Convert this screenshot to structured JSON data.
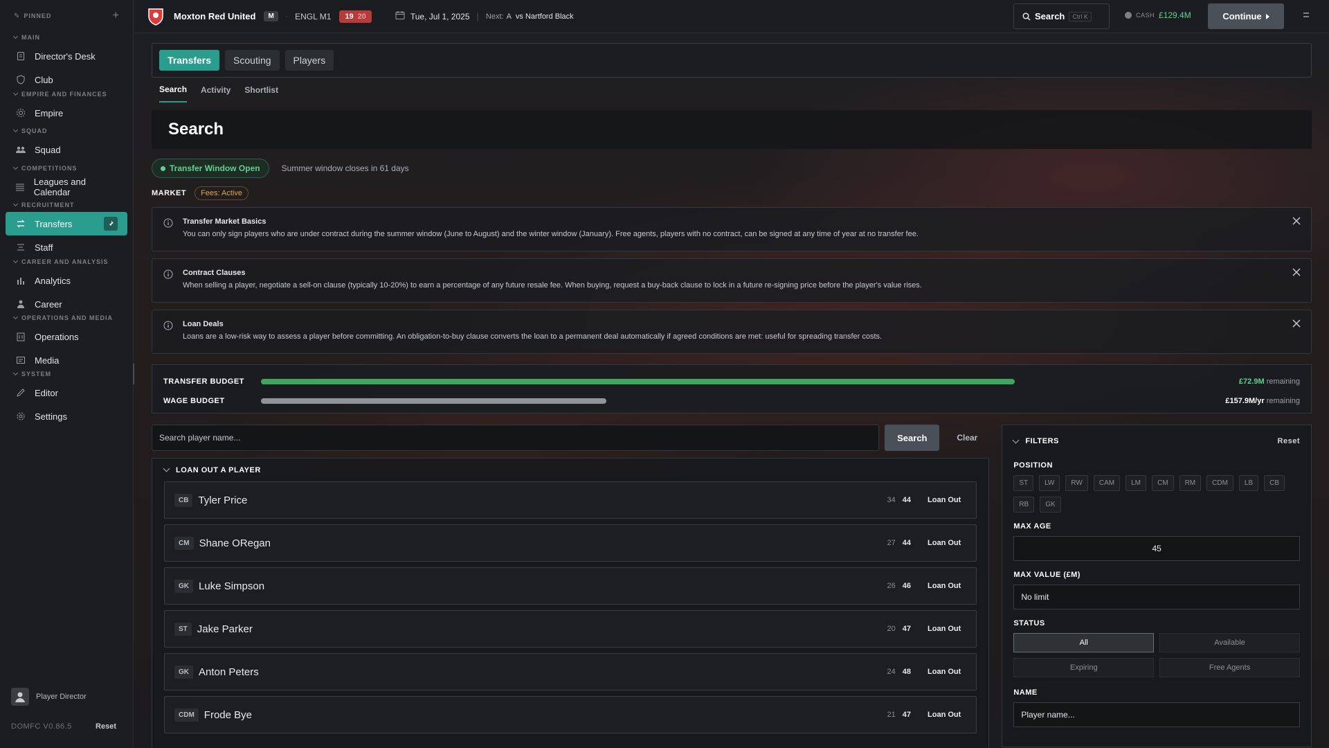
{
  "sidebar": {
    "pinned_label": "PINNED",
    "sections": [
      {
        "label": "MAIN",
        "items": [
          {
            "label": "Director's Desk",
            "icon": "document-icon"
          },
          {
            "label": "Club",
            "icon": "shield-icon"
          }
        ]
      },
      {
        "label": "EMPIRE AND FINANCES",
        "items": [
          {
            "label": "Empire",
            "icon": "gear-icon"
          }
        ]
      },
      {
        "label": "SQUAD",
        "items": [
          {
            "label": "Squad",
            "icon": "people-icon"
          }
        ]
      },
      {
        "label": "COMPETITIONS",
        "items": [
          {
            "label": "Leagues and Calendar",
            "icon": "list-icon"
          }
        ]
      },
      {
        "label": "RECRUITMENT",
        "items": [
          {
            "label": "Transfers",
            "icon": "swap-icon"
          },
          {
            "label": "Staff",
            "icon": "staff-icon"
          }
        ]
      },
      {
        "label": "CAREER AND ANALYSIS",
        "items": [
          {
            "label": "Analytics",
            "icon": "bar-chart-icon"
          },
          {
            "label": "Career",
            "icon": "person-icon"
          }
        ]
      },
      {
        "label": "OPERATIONS AND MEDIA",
        "items": [
          {
            "label": "Operations",
            "icon": "building-icon"
          },
          {
            "label": "Media",
            "icon": "media-icon"
          }
        ]
      },
      {
        "label": "SYSTEM",
        "items": [
          {
            "label": "Editor",
            "icon": "pencil-icon"
          },
          {
            "label": "Settings",
            "icon": "settings-icon"
          }
        ]
      }
    ],
    "user_label": "Player Director",
    "version": "DOMFC V0.86.5",
    "reset_label": "Reset"
  },
  "topbar": {
    "club_name": "Moxton Red United",
    "mode_badge": "M",
    "league": "ENGL M1",
    "league_pos": "19",
    "league_pts": "20",
    "date": "Tue, Jul 1, 2025",
    "next_label": "Next:",
    "next_venue": "A",
    "next_opponent": "vs Nartford Black",
    "search_label": "Search",
    "search_shortcut": "Ctrl K",
    "cash_label": "CASH",
    "cash_value": "£129.4M",
    "continue_label": "Continue"
  },
  "tabs": [
    "Transfers",
    "Scouting",
    "Players"
  ],
  "subtabs": [
    "Search",
    "Activity",
    "Shortlist"
  ],
  "page_title": "Search",
  "window_status": "Transfer Window Open",
  "window_note": "Summer window closes in 61 days",
  "market_label": "MARKET",
  "fees_label": "Fees: Active",
  "info_boxes": [
    {
      "title": "Transfer Market Basics",
      "text": "You can only sign players who are under contract during the summer window (June to August) and the winter window (January). Free agents, players with no contract, can be signed at any time of year at no transfer fee."
    },
    {
      "title": "Contract Clauses",
      "text": "When selling a player, negotiate a sell-on clause (typically 10-20%) to earn a percentage of any future resale fee. When buying, request a buy-back clause to lock in a future re-signing price before the player's value rises."
    },
    {
      "title": "Loan Deals",
      "text": "Loans are a low-risk way to assess a player before committing. An obligation-to-buy clause converts the loan to a permanent deal automatically if agreed conditions are met: useful for spreading transfer costs."
    }
  ],
  "budgets": [
    {
      "label": "TRANSFER BUDGET",
      "value": "£72.9M",
      "suffix": "remaining",
      "fill_fraction": 0.82,
      "color": "#3fa65e"
    },
    {
      "label": "WAGE BUDGET",
      "value": "£157.9M/yr",
      "suffix": "remaining",
      "fill_fraction": 0.376,
      "color": "#8f949a"
    }
  ],
  "search": {
    "placeholder": "Search player name...",
    "search_label": "Search",
    "clear_label": "Clear"
  },
  "loan_panel": {
    "title": "LOAN OUT A PLAYER",
    "action_label": "Loan Out",
    "players": [
      {
        "pos": "CB",
        "name": "Tyler Price",
        "age": "34",
        "ovr": "44"
      },
      {
        "pos": "CM",
        "name": "Shane ORegan",
        "age": "27",
        "ovr": "44"
      },
      {
        "pos": "GK",
        "name": "Luke Simpson",
        "age": "26",
        "ovr": "46"
      },
      {
        "pos": "ST",
        "name": "Jake Parker",
        "age": "20",
        "ovr": "47"
      },
      {
        "pos": "GK",
        "name": "Anton Peters",
        "age": "24",
        "ovr": "48"
      },
      {
        "pos": "CDM",
        "name": "Frode Bye",
        "age": "21",
        "ovr": "47"
      }
    ]
  },
  "filters": {
    "title": "FILTERS",
    "reset_label": "Reset",
    "position_label": "POSITION",
    "positions": [
      "ST",
      "LW",
      "RW",
      "CAM",
      "LM",
      "CM",
      "RM",
      "CDM",
      "LB",
      "CB",
      "RB",
      "GK"
    ],
    "max_age_label": "MAX AGE",
    "max_age_value": "45",
    "max_value_label": "MAX VALUE (£M)",
    "max_value_placeholder": "No limit",
    "status_label": "STATUS",
    "statuses": [
      "All",
      "Available",
      "Expiring",
      "Free Agents"
    ],
    "name_label": "NAME",
    "name_placeholder": "Player name..."
  },
  "colors": {
    "accent": "#2a9d8f",
    "green": "#5fd38d",
    "danger": "#b83a3a"
  }
}
